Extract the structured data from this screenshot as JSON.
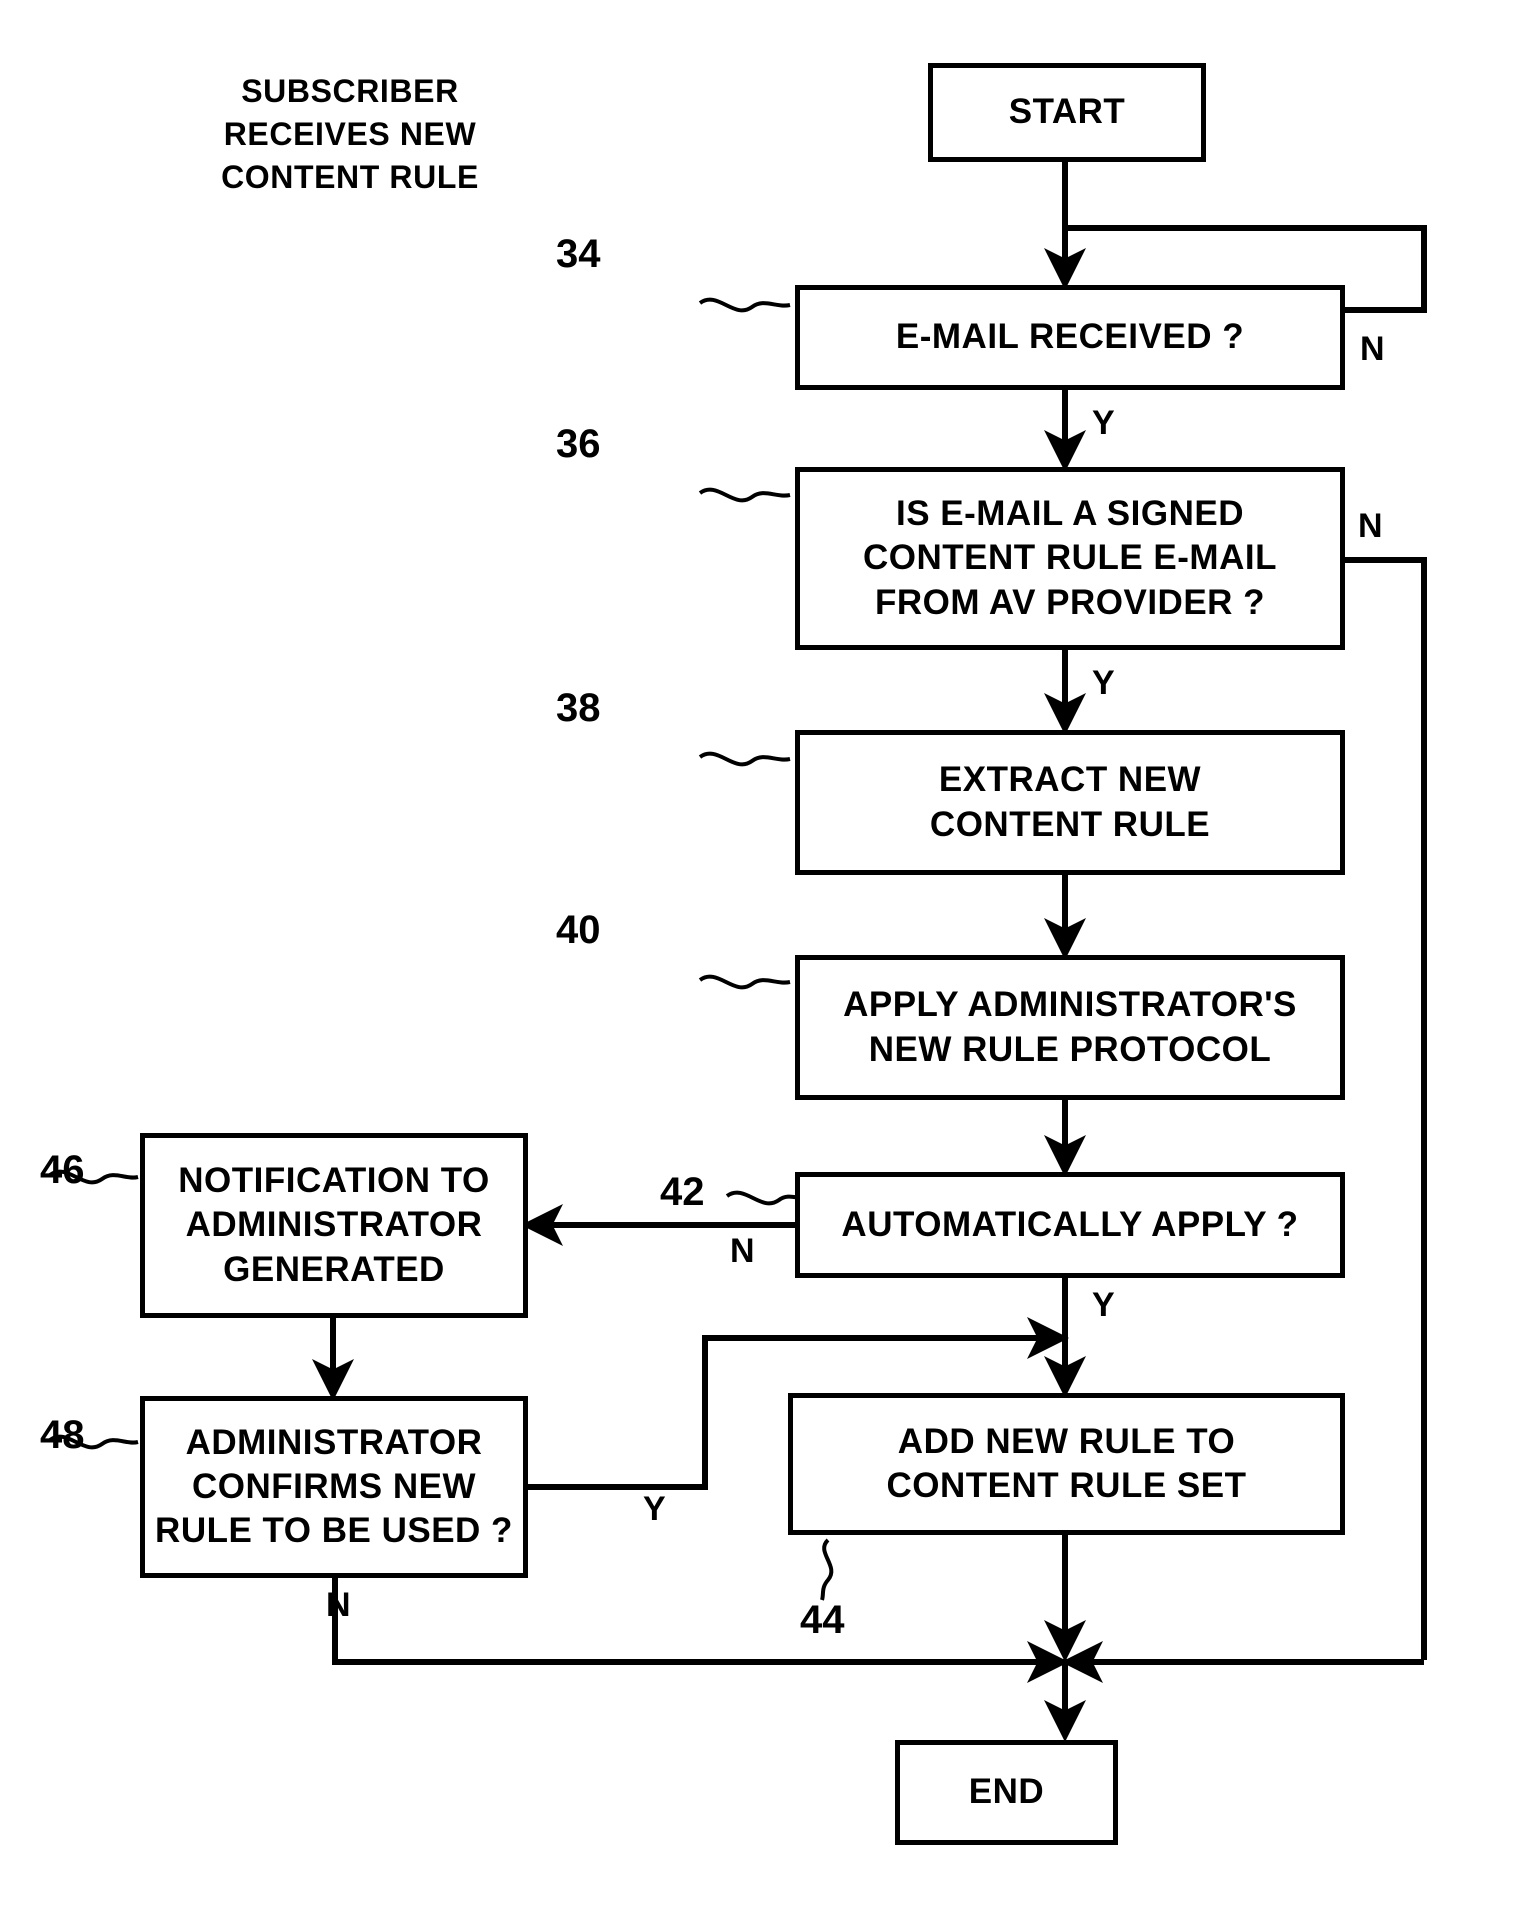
{
  "diagram": {
    "title_lines": [
      "SUBSCRIBER",
      "RECEIVES NEW",
      "CONTENT RULE"
    ],
    "stroke_color": "#000000",
    "background_color": "#ffffff"
  },
  "nodes": {
    "start": {
      "ref": "",
      "lines": [
        "START"
      ]
    },
    "n34": {
      "ref": "34",
      "lines": [
        "E-MAIL RECEIVED ?"
      ]
    },
    "n36": {
      "ref": "36",
      "lines": [
        "IS E-MAIL A SIGNED",
        "CONTENT RULE E-MAIL",
        "FROM AV PROVIDER ?"
      ]
    },
    "n38": {
      "ref": "38",
      "lines": [
        "EXTRACT NEW",
        "CONTENT RULE"
      ]
    },
    "n40": {
      "ref": "40",
      "lines": [
        "APPLY ADMINISTRATOR'S",
        "NEW RULE PROTOCOL"
      ]
    },
    "n42": {
      "ref": "42",
      "lines": [
        "AUTOMATICALLY APPLY ?"
      ]
    },
    "n46": {
      "ref": "46",
      "lines": [
        "NOTIFICATION TO",
        "ADMINISTRATOR",
        "GENERATED"
      ]
    },
    "n48": {
      "ref": "48",
      "lines": [
        "ADMINISTRATOR",
        "CONFIRMS NEW",
        "RULE TO BE USED ?"
      ]
    },
    "n44": {
      "ref": "44",
      "lines": [
        "ADD NEW RULE TO",
        "CONTENT RULE SET"
      ]
    },
    "end": {
      "ref": "",
      "lines": [
        "END"
      ]
    }
  },
  "branch_labels": {
    "n34_no": "N",
    "n34_yes": "Y",
    "n36_no": "N",
    "n36_yes": "Y",
    "n42_no": "N",
    "n42_yes": "Y",
    "n48_yes": "Y",
    "n48_no": "N"
  }
}
